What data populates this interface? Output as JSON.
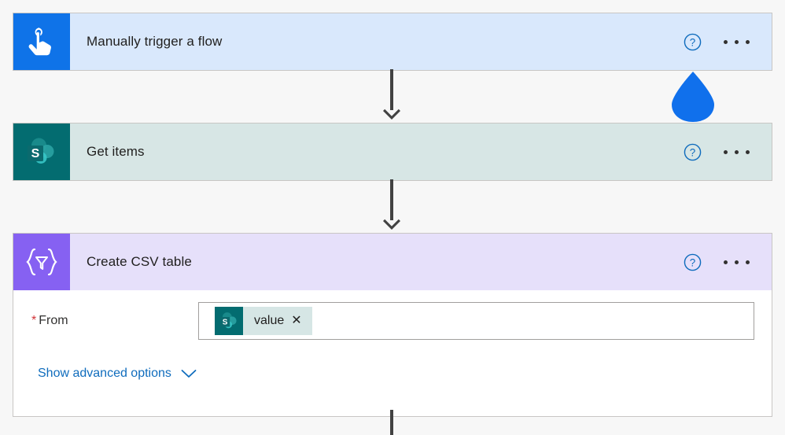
{
  "app": {
    "name": "Power Automate flow designer",
    "background_color": "#f7f7f7"
  },
  "colors": {
    "trigger_header": "#d9e8fc",
    "trigger_icon": "#0f73e8",
    "sharepoint_header": "#d7e6e5",
    "sharepoint_icon": "#036c70",
    "dataop_header": "#e6e0fa",
    "dataop_icon": "#8661f2",
    "link_blue": "#0f6cbd",
    "required_red": "#d13438",
    "connector_gray": "#424242",
    "cursor_blue": "#1070ec",
    "card_border": "#c8c6c4"
  },
  "cards": [
    {
      "id": "trigger",
      "title": "Manually trigger a flow",
      "icon_name": "manual-trigger-tap-icon",
      "help_icon": "help-question-icon",
      "more_icon": "more-options-ellipsis-icon"
    },
    {
      "id": "getitems",
      "title": "Get items",
      "icon_name": "sharepoint-icon",
      "help_icon": "help-question-icon",
      "more_icon": "more-options-ellipsis-icon"
    },
    {
      "id": "csv",
      "title": "Create CSV table",
      "icon_name": "data-operations-icon",
      "help_icon": "help-question-icon",
      "more_icon": "more-options-ellipsis-icon",
      "fields": [
        {
          "label": "From",
          "required": true,
          "required_marker": "*",
          "token": {
            "label": "value",
            "remove_label": "✕",
            "icon_name": "sharepoint-icon"
          }
        }
      ],
      "advanced": {
        "label": "Show advanced options",
        "chevron_icon": "chevron-down-icon"
      }
    }
  ],
  "connectors": [
    {
      "id": "trigger-to-getitems",
      "icon_name": "arrow-down-icon"
    },
    {
      "id": "getitems-to-csv",
      "icon_name": "arrow-down-icon"
    },
    {
      "id": "csv-to-next",
      "icon_name": "flow-line"
    }
  ],
  "cursor": {
    "icon_name": "water-drop-cursor-icon",
    "color": "#1070ec"
  }
}
